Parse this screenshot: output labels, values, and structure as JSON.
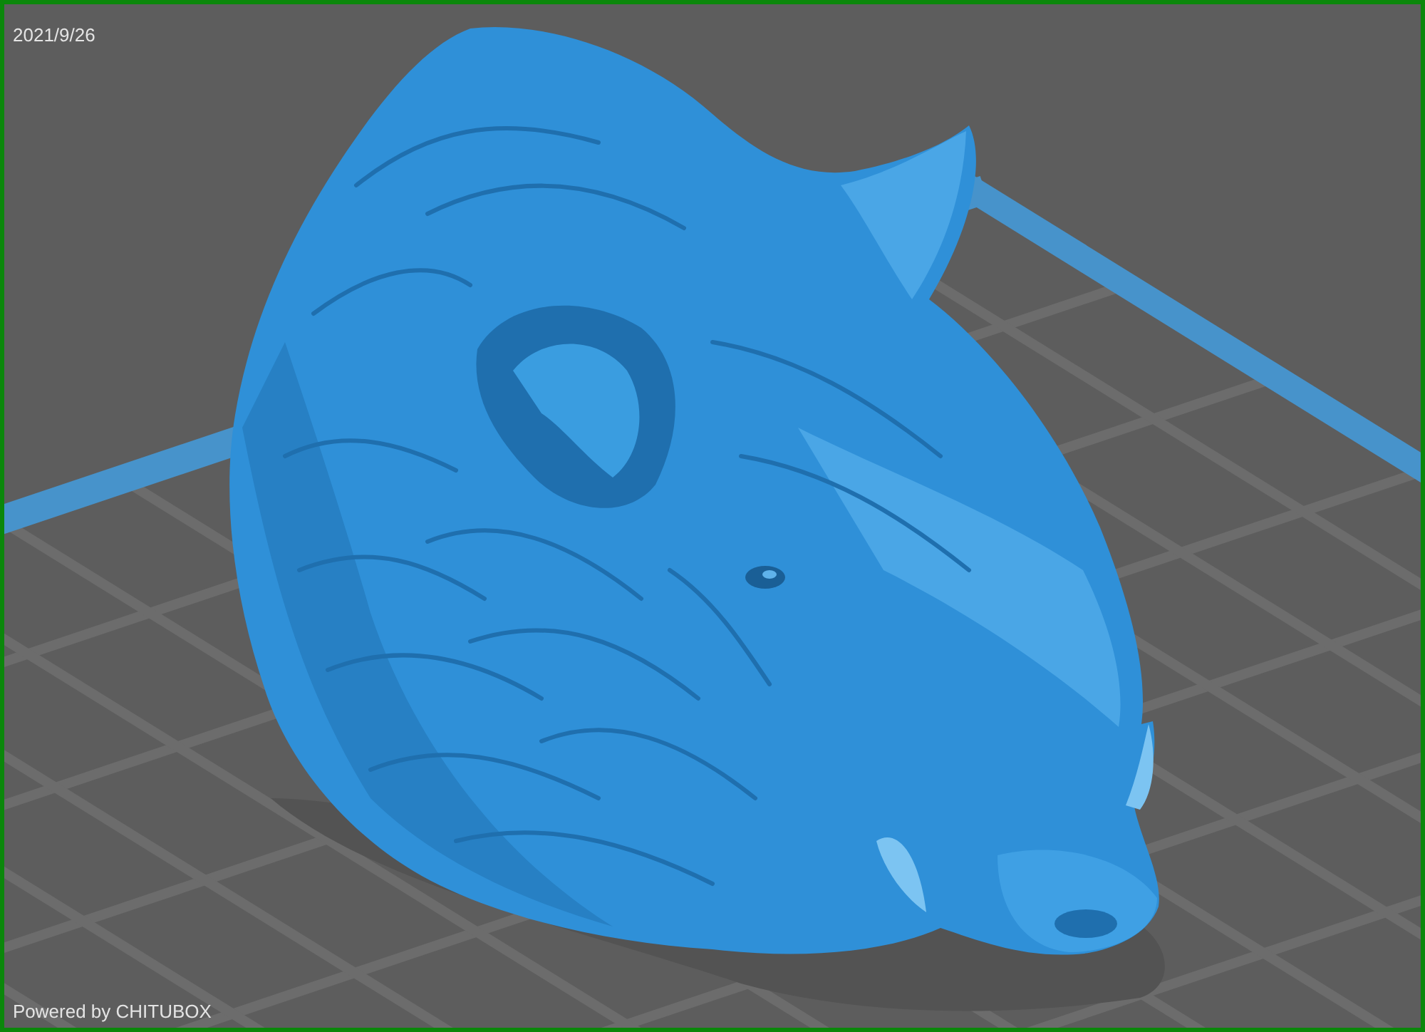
{
  "viewport": {
    "date_label": "2021/9/26",
    "credit_label": "Powered by CHITUBOX"
  }
}
